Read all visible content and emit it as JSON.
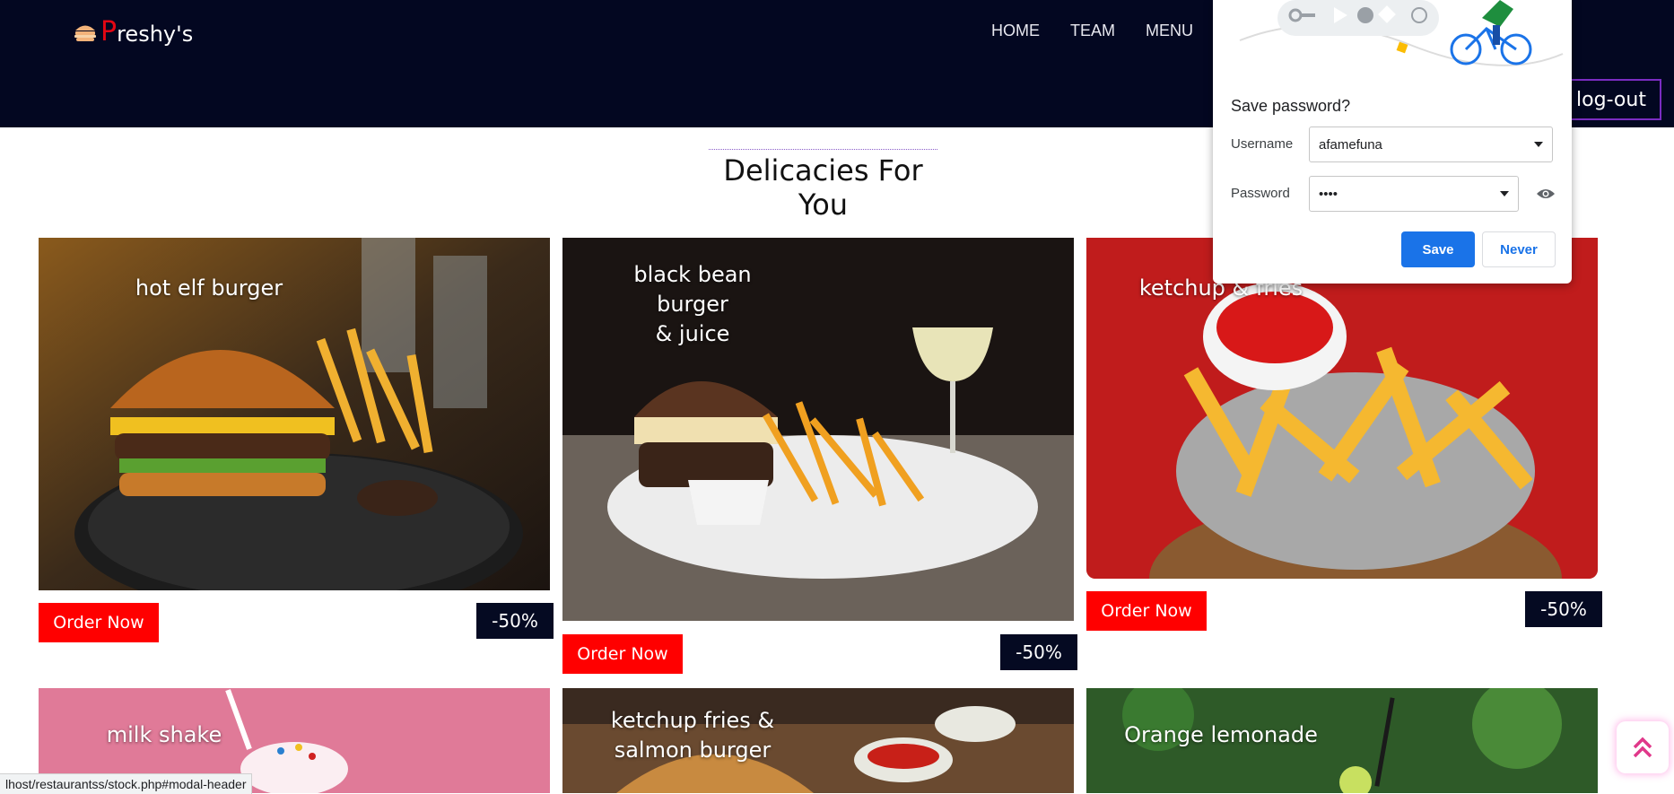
{
  "header": {
    "brand_first": "P",
    "brand_rest": "reshy's",
    "nav": [
      "HOME",
      "TEAM",
      "MENU"
    ],
    "logout_label": "log-out"
  },
  "section_title": "Delicacies For You",
  "cards": [
    {
      "caption": "hot elf burger",
      "order_label": "Order Now",
      "discount": "-50%"
    },
    {
      "caption": "black bean burger\n& juice",
      "order_label": "Order Now",
      "discount": "-50%"
    },
    {
      "caption": "ketchup & fries",
      "order_label": "Order Now",
      "discount": "-50%"
    },
    {
      "caption": "milk shake"
    },
    {
      "caption": "ketchup fries &\nsalmon burger"
    },
    {
      "caption": "Orange lemonade"
    }
  ],
  "password_dialog": {
    "title": "Save password?",
    "username_label": "Username",
    "username_value": "afamefuna",
    "password_label": "Password",
    "password_value": "••••",
    "save_label": "Save",
    "never_label": "Never"
  },
  "status_bar_url": "lhost/restaurantss/stock.php#modal-header",
  "colors": {
    "header_bg": "#030721",
    "accent_red": "#ff0000",
    "discount_bg": "#050a22",
    "logout_border": "#7a2cc1",
    "save_blue": "#1a73e8"
  },
  "icons": [
    "burger-logo-icon",
    "key-icon",
    "eye-icon",
    "double-chevron-up-icon",
    "dropdown-caret-icon"
  ]
}
